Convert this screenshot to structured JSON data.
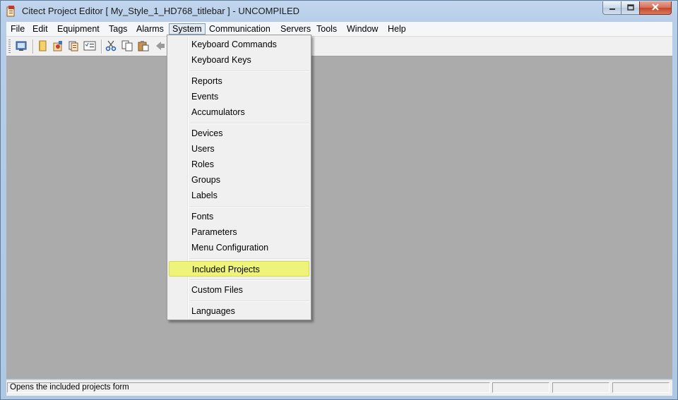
{
  "window": {
    "title": "Citect Project Editor [ My_Style_1_HD768_titlebar ] - UNCOMPILED",
    "controls": {
      "minimize": "minimize-icon",
      "maximize": "maximize-icon",
      "close": "close-icon"
    }
  },
  "menubar": {
    "items": [
      {
        "label": "File"
      },
      {
        "label": "Edit"
      },
      {
        "label": "Equipment"
      },
      {
        "label": "Tags"
      },
      {
        "label": "Alarms"
      },
      {
        "label": "System"
      },
      {
        "label": "Communication"
      },
      {
        "label": "Servers"
      },
      {
        "label": "Tools"
      },
      {
        "label": "Window"
      },
      {
        "label": "Help"
      }
    ],
    "open_menu": "System"
  },
  "toolbar": {
    "icons": [
      "compile-icon",
      "new-icon",
      "open-project-icon",
      "copy-document-icon",
      "checklist-icon",
      "cut-icon",
      "copy-icon",
      "paste-icon",
      "back-icon"
    ]
  },
  "system_menu": {
    "groups": [
      [
        {
          "label": "Keyboard Commands"
        },
        {
          "label": "Keyboard Keys"
        }
      ],
      [
        {
          "label": "Reports"
        },
        {
          "label": "Events"
        },
        {
          "label": "Accumulators"
        }
      ],
      [
        {
          "label": "Devices"
        },
        {
          "label": "Users"
        },
        {
          "label": "Roles"
        },
        {
          "label": "Groups"
        },
        {
          "label": "Labels"
        }
      ],
      [
        {
          "label": "Fonts"
        },
        {
          "label": "Parameters"
        },
        {
          "label": "Menu Configuration"
        }
      ],
      [
        {
          "label": "Included Projects"
        }
      ],
      [
        {
          "label": "Custom Files"
        }
      ],
      [
        {
          "label": "Languages"
        }
      ]
    ],
    "highlighted": "Included Projects",
    "highlight_color": "#eef37a"
  },
  "statusbar": {
    "message": "Opens the included projects form",
    "panes": [
      "",
      "",
      ""
    ]
  },
  "colors": {
    "workspace": "#ababab",
    "title_bar": "#b9d1ea",
    "close_button": "#c3462b"
  }
}
